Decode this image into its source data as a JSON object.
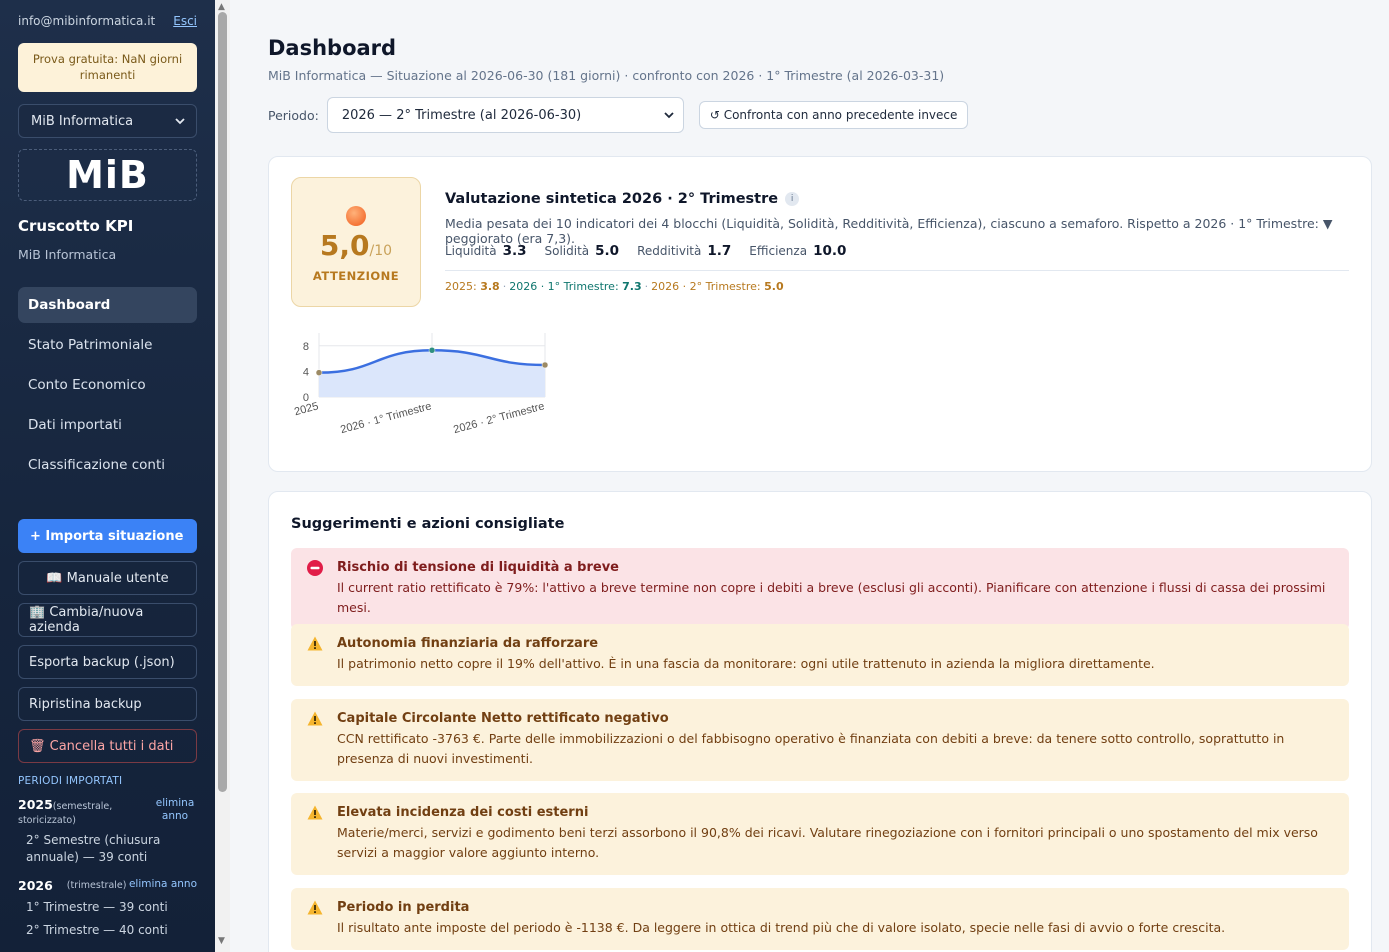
{
  "sidebar": {
    "email": "info@mibinformatica.it",
    "logout": "Esci",
    "trial": "Prova gratuita: NaN giorni rimanenti",
    "company": "MiB Informatica",
    "logo": "MiB",
    "title": "Cruscotto KPI",
    "subtitle": "MiB Informatica",
    "nav": [
      "Dashboard",
      "Stato Patrimoniale",
      "Conto Economico",
      "Dati importati",
      "Classificazione conti"
    ],
    "import_btn": "+ Importa situazione",
    "manual_btn": "📖 Manuale utente",
    "change_company_btn": "🏢 Cambia/nuova azienda",
    "export_btn": "Esporta backup (.json)",
    "restore_btn": "Ripristina backup",
    "delete_btn": "🗑 Cancella tutti i dati",
    "periods_header": "PERIODI IMPORTATI",
    "periods": [
      {
        "year": "2025",
        "kind": "(semestrale, storicizzato)",
        "delete": "elimina anno",
        "lines": [
          "2° Semestre (chiusura annuale) — 39 conti"
        ]
      },
      {
        "year": "2026",
        "kind": "(trimestrale)",
        "delete": "elimina anno",
        "lines": [
          "1° Trimestre — 39 conti",
          "2° Trimestre — 40 conti"
        ]
      }
    ]
  },
  "main": {
    "title": "Dashboard",
    "subtitle": "MiB Informatica — Situazione al 2026-06-30 (181 giorni) · confronto con 2026 · 1° Trimestre (al 2026-03-31)",
    "period_label": "Periodo:",
    "period_value": "2026 — 2° Trimestre (al 2026-06-30)",
    "compare_btn": "↺ Confronta con anno precedente invece"
  },
  "evaluation": {
    "score": "5,0",
    "score_den": "/10",
    "status": "ATTENZIONE",
    "title": "Valutazione sintetica 2026 · 2° Trimestre",
    "info": "i",
    "description": "Media pesata dei 10 indicatori dei 4 blocchi (Liquidità, Solidità, Redditività, Efficienza), ciascuno a semaforo. Rispetto a 2026 · 1° Trimestre: ▼ peggiorato (era 7,3).",
    "blocks": [
      {
        "label": "Liquidità",
        "value": "3.3"
      },
      {
        "label": "Solidità",
        "value": "5.0"
      },
      {
        "label": "Redditività",
        "value": "1.7"
      },
      {
        "label": "Efficienza",
        "value": "10.0"
      }
    ],
    "history": [
      {
        "label": "2025:",
        "value": "3.8"
      },
      {
        "label": "2026 · 1° Trimestre:",
        "value": "7.3"
      },
      {
        "label": "2026 · 2° Trimestre:",
        "value": "5.0"
      }
    ]
  },
  "chart_data": {
    "type": "area",
    "categories": [
      "2025",
      "2026 · 1° Trimestre",
      "2026 · 2° Trimestre"
    ],
    "values": [
      3.8,
      7.3,
      5.0
    ],
    "yticks": [
      "0",
      "4",
      "8"
    ],
    "ylim": [
      0,
      10
    ],
    "grid": true,
    "colors": {
      "line": "#3b6fe0",
      "fill": "#dbe6fb"
    }
  },
  "suggestions": {
    "title": "Suggerimenti e azioni consigliate",
    "items": [
      {
        "level": "danger",
        "title": "Rischio di tensione di liquidità a breve",
        "text": "Il current ratio rettificato è 79%: l'attivo a breve termine non copre i debiti a breve (esclusi gli acconti). Pianificare con attenzione i flussi di cassa dei prossimi mesi."
      },
      {
        "level": "warning",
        "title": "Autonomia finanziaria da rafforzare",
        "text": "Il patrimonio netto copre il 19% dell'attivo. È in una fascia da monitorare: ogni utile trattenuto in azienda la migliora direttamente."
      },
      {
        "level": "warning",
        "title": "Capitale Circolante Netto rettificato negativo",
        "text": "CCN rettificato -3763 €. Parte delle immobilizzazioni o del fabbisogno operativo è finanziata con debiti a breve: da tenere sotto controllo, soprattutto in presenza di nuovi investimenti."
      },
      {
        "level": "warning",
        "title": "Elevata incidenza dei costi esterni",
        "text": "Materie/merci, servizi e godimento beni terzi assorbono il 90,8% dei ricavi. Valutare rinegoziazione con i fornitori principali o uno spostamento del mix verso servizi a maggior valore aggiunto interno."
      },
      {
        "level": "warning",
        "title": "Periodo in perdita",
        "text": "Il risultato ante imposte del periodo è -1138 €. Da leggere in ottica di trend più che di valore isolato, specie nelle fasi di avvio o forte crescita."
      }
    ]
  }
}
